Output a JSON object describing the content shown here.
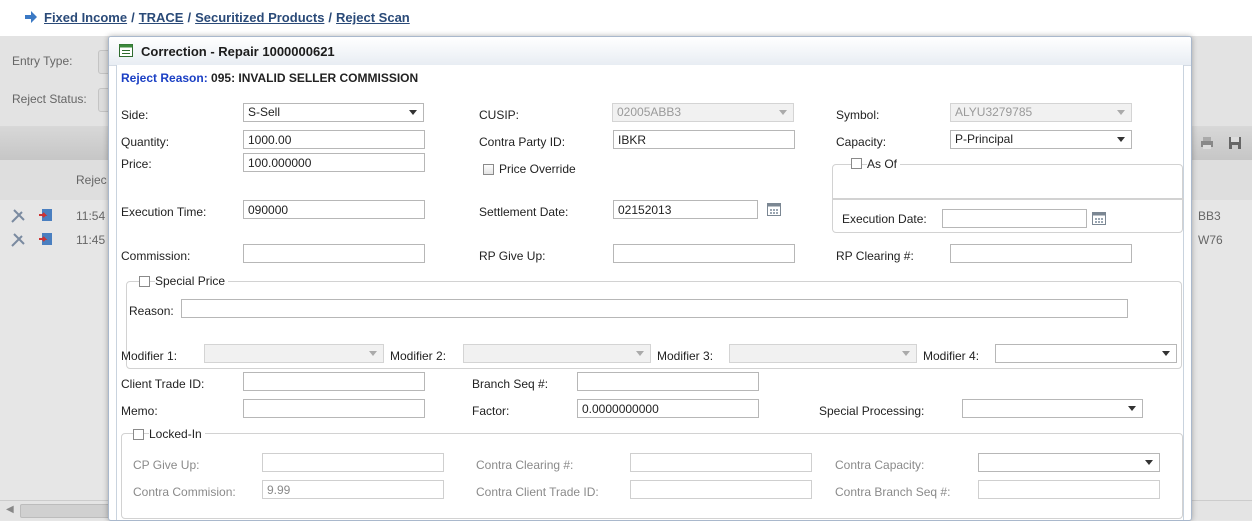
{
  "breadcrumb": {
    "items": [
      "Fixed Income",
      "TRACE",
      "Securitized Products",
      "Reject Scan"
    ],
    "separator": "/"
  },
  "background": {
    "filter_labels": {
      "entry_type": "Entry Type:",
      "reject_status": "Reject Status:"
    },
    "column_header": "Rejec",
    "rows": [
      {
        "time": "11:54",
        "right_text": "BB3"
      },
      {
        "time": "11:45",
        "right_text": "W76"
      }
    ]
  },
  "dialog": {
    "title": "Correction - Repair 1000000621",
    "reject_reason_label": "Reject Reason:",
    "reject_reason_value": "095: INVALID SELLER COMMISSION",
    "fields": {
      "side": {
        "label": "Side:",
        "value": "S-Sell"
      },
      "cusip": {
        "label": "CUSIP:",
        "value": "02005ABB3"
      },
      "symbol": {
        "label": "Symbol:",
        "value": "ALYU3279785"
      },
      "quantity": {
        "label": "Quantity:",
        "value": "1000.00"
      },
      "contra_party_id": {
        "label": "Contra Party ID:",
        "value": "IBKR"
      },
      "capacity": {
        "label": "Capacity:",
        "value": "P-Principal"
      },
      "price": {
        "label": "Price:",
        "value": "100.000000"
      },
      "price_override": {
        "label": "Price Override",
        "checked": false
      },
      "as_of": {
        "label": "As Of",
        "checked": false
      },
      "execution_time": {
        "label": "Execution Time:",
        "value": "090000"
      },
      "settlement_date": {
        "label": "Settlement Date:",
        "value": "02152013"
      },
      "execution_date": {
        "label": "Execution Date:",
        "value": ""
      },
      "commission": {
        "label": "Commission:",
        "value": ""
      },
      "rp_give_up": {
        "label": "RP Give Up:",
        "value": ""
      },
      "rp_clearing": {
        "label": "RP Clearing #:",
        "value": ""
      },
      "special_price": {
        "label": "Special Price",
        "checked": false
      },
      "reason": {
        "label": "Reason:",
        "value": ""
      },
      "modifier1": {
        "label": "Modifier 1:",
        "value": ""
      },
      "modifier2": {
        "label": "Modifier 2:",
        "value": ""
      },
      "modifier3": {
        "label": "Modifier 3:",
        "value": ""
      },
      "modifier4": {
        "label": "Modifier 4:",
        "value": ""
      },
      "client_trade_id": {
        "label": "Client Trade ID:",
        "value": ""
      },
      "branch_seq": {
        "label": "Branch Seq #:",
        "value": ""
      },
      "memo": {
        "label": "Memo:",
        "value": ""
      },
      "factor": {
        "label": "Factor:",
        "value": "0.0000000000"
      },
      "special_processing": {
        "label": "Special Processing:",
        "value": ""
      },
      "locked_in": {
        "label": "Locked-In",
        "checked": false
      },
      "cp_give_up": {
        "label": "CP Give Up:",
        "value": ""
      },
      "contra_clearing": {
        "label": "Contra Clearing #:",
        "value": ""
      },
      "contra_capacity": {
        "label": "Contra Capacity:",
        "value": ""
      },
      "contra_commission": {
        "label": "Contra Commision:",
        "value": "9.99"
      },
      "contra_client_trade_id": {
        "label": "Contra Client Trade ID:",
        "value": ""
      },
      "contra_branch_seq": {
        "label": "Contra Branch Seq #:",
        "value": ""
      }
    }
  },
  "colors": {
    "link": "#2a4a78",
    "reject_label": "#1a3fc4",
    "disabled_text": "#8a8a8a"
  }
}
